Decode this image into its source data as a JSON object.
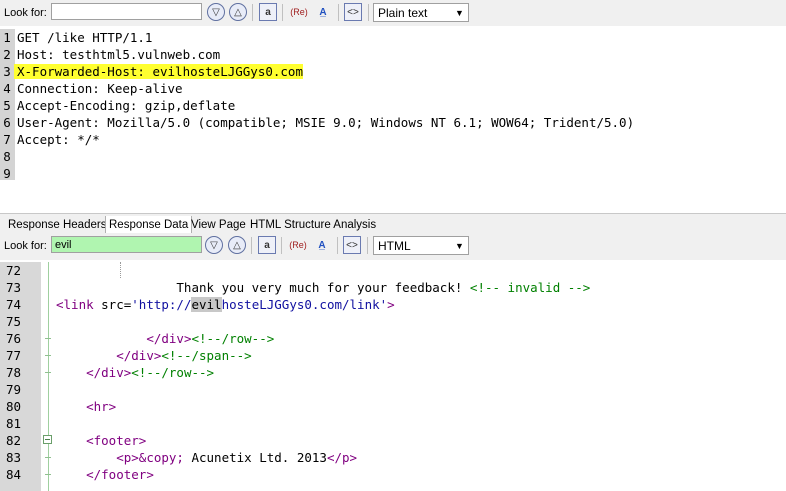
{
  "top_toolbar": {
    "look_for_label": "Look for:",
    "search_value": "",
    "syntax_select": "Plain text"
  },
  "request_lines": [
    {
      "num": "1",
      "text": "GET /like HTTP/1.1"
    },
    {
      "num": "2",
      "text": "Host: testhtml5.vulnweb.com"
    },
    {
      "num": "3",
      "text": "X-Forwarded-Host: evilhosteLJGGys0.com",
      "highlight": true
    },
    {
      "num": "4",
      "text": "Connection: Keep-alive"
    },
    {
      "num": "5",
      "text": "Accept-Encoding: gzip,deflate"
    },
    {
      "num": "6",
      "text": "User-Agent: Mozilla/5.0 (compatible; MSIE 9.0; Windows NT 6.1; WOW64; Trident/5.0)"
    },
    {
      "num": "7",
      "text": "Accept: */*"
    },
    {
      "num": "8",
      "text": ""
    },
    {
      "num": "9",
      "text": ""
    }
  ],
  "tabs": [
    {
      "label": "Response Headers",
      "active": false
    },
    {
      "label": "Response Data",
      "active": true
    },
    {
      "label": "View Page",
      "active": false
    },
    {
      "label": "HTML Structure Analysis",
      "active": false
    }
  ],
  "bottom_toolbar": {
    "look_for_label": "Look for:",
    "search_value": "evil",
    "syntax_select": "HTML"
  },
  "icons": {
    "find_next": "chevron-down-icon",
    "find_prev": "chevron-up-icon",
    "match_case": "match-case-icon",
    "regex": "regex-icon",
    "highlight_all": "highlight-all-icon",
    "word_wrap": "code-view-icon"
  },
  "response_lines": [
    {
      "num": "72",
      "segments": []
    },
    {
      "num": "73",
      "segments": [
        {
          "t": "txt",
          "v": "                Thank you very much for your feedback! "
        },
        {
          "t": "cmt",
          "v": "<!-- invalid -->"
        }
      ]
    },
    {
      "num": "74",
      "segments": [
        {
          "t": "tag",
          "v": "<link "
        },
        {
          "t": "attr",
          "v": "src="
        },
        {
          "t": "str",
          "v": "'http://"
        },
        {
          "t": "match",
          "v": "evil"
        },
        {
          "t": "str",
          "v": "hosteLJGGys0.com/link'"
        },
        {
          "t": "tag",
          "v": ">"
        }
      ]
    },
    {
      "num": "75",
      "segments": []
    },
    {
      "num": "76",
      "segments": [
        {
          "t": "txt",
          "v": "            "
        },
        {
          "t": "tag",
          "v": "</div>"
        },
        {
          "t": "cmt",
          "v": "<!--/row-->"
        }
      ]
    },
    {
      "num": "77",
      "segments": [
        {
          "t": "txt",
          "v": "        "
        },
        {
          "t": "tag",
          "v": "</div>"
        },
        {
          "t": "cmt",
          "v": "<!--/span-->"
        }
      ]
    },
    {
      "num": "78",
      "segments": [
        {
          "t": "txt",
          "v": "    "
        },
        {
          "t": "tag",
          "v": "</div>"
        },
        {
          "t": "cmt",
          "v": "<!--/row-->"
        }
      ]
    },
    {
      "num": "79",
      "segments": []
    },
    {
      "num": "80",
      "segments": [
        {
          "t": "txt",
          "v": "    "
        },
        {
          "t": "tag",
          "v": "<hr>"
        }
      ]
    },
    {
      "num": "81",
      "segments": []
    },
    {
      "num": "82",
      "segments": [
        {
          "t": "txt",
          "v": "    "
        },
        {
          "t": "tag",
          "v": "<footer>"
        }
      ]
    },
    {
      "num": "83",
      "segments": [
        {
          "t": "txt",
          "v": "        "
        },
        {
          "t": "tag",
          "v": "<p>"
        },
        {
          "t": "ent",
          "v": "&copy;"
        },
        {
          "t": "txt",
          "v": " Acunetix Ltd. 2013"
        },
        {
          "t": "tag",
          "v": "</p>"
        }
      ]
    },
    {
      "num": "84",
      "segments": [
        {
          "t": "txt",
          "v": "    "
        },
        {
          "t": "tag",
          "v": "</footer>"
        }
      ]
    }
  ]
}
